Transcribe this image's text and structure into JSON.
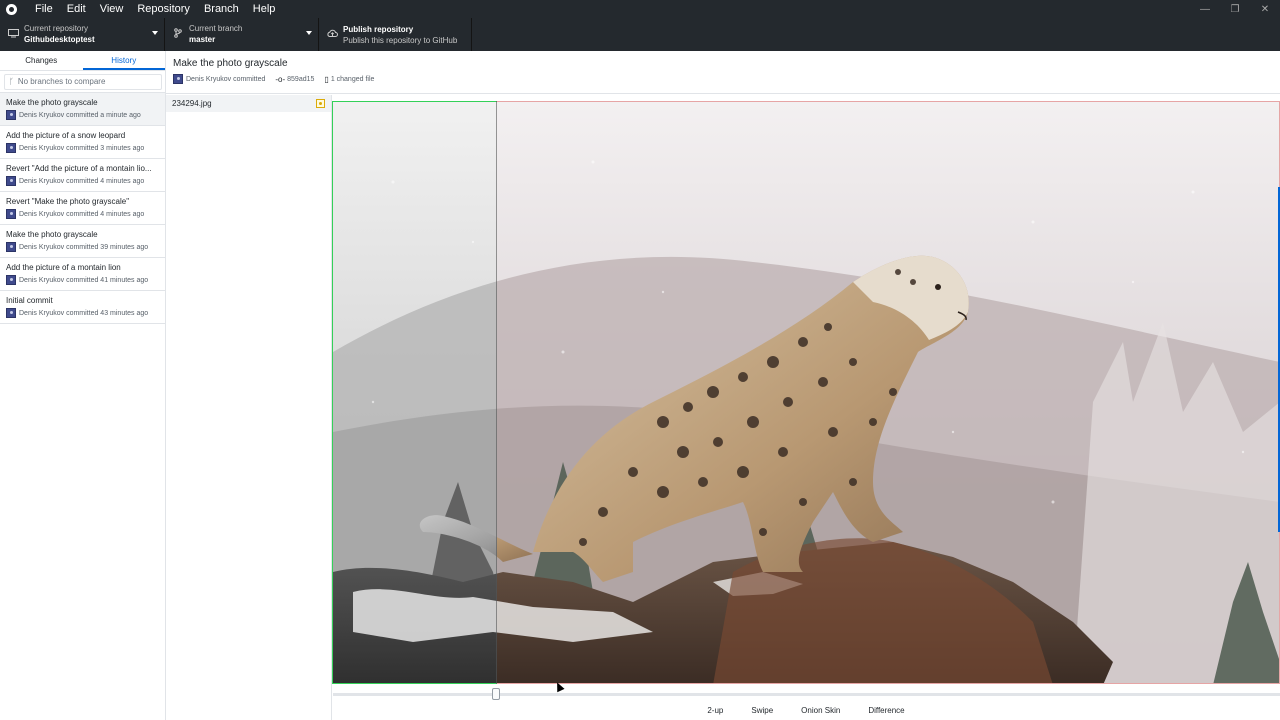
{
  "menu": [
    "File",
    "Edit",
    "View",
    "Repository",
    "Branch",
    "Help"
  ],
  "window_controls": {
    "minimize": "—",
    "restore": "❐",
    "close": "✕"
  },
  "toolbar": {
    "repo_label": "Current repository",
    "repo_value": "Githubdesktoptest",
    "branch_label": "Current branch",
    "branch_value": "master",
    "publish_title": "Publish repository",
    "publish_sub": "Publish this repository to GitHub"
  },
  "sidebar": {
    "tabs": [
      "Changes",
      "History"
    ],
    "active_tab": "History",
    "compare_placeholder": "No branches to compare",
    "commits": [
      {
        "title": "Make the photo grayscale",
        "meta": "Denis Kryukov committed a minute ago"
      },
      {
        "title": "Add the picture of a snow leopard",
        "meta": "Denis Kryukov committed 3 minutes ago"
      },
      {
        "title": "Revert \"Add the picture of a montain lio...",
        "meta": "Denis Kryukov committed 4 minutes ago"
      },
      {
        "title": "Revert \"Make the photo grayscale\"",
        "meta": "Denis Kryukov committed 4 minutes ago"
      },
      {
        "title": "Make the photo grayscale",
        "meta": "Denis Kryukov committed 39 minutes ago"
      },
      {
        "title": "Add the picture of a montain lion",
        "meta": "Denis Kryukov committed 41 minutes ago"
      },
      {
        "title": "Initial commit",
        "meta": "Denis Kryukov committed 43 minutes ago"
      }
    ]
  },
  "header": {
    "title": "Make the photo grayscale",
    "author": "Denis Kryukov committed",
    "sha": "859ad15",
    "files_changed": "1 changed file"
  },
  "files": [
    {
      "name": "234294.jpg",
      "status": "modified"
    }
  ],
  "diff": {
    "modes": [
      "2-up",
      "Swipe",
      "Onion Skin",
      "Difference"
    ],
    "swipe_position": 0.174
  },
  "colors": {
    "accent": "#0366d6",
    "added": "#34d058",
    "removed": "#e6a5a5",
    "modified": "#dbab09",
    "toolbar_bg": "#24292e"
  }
}
